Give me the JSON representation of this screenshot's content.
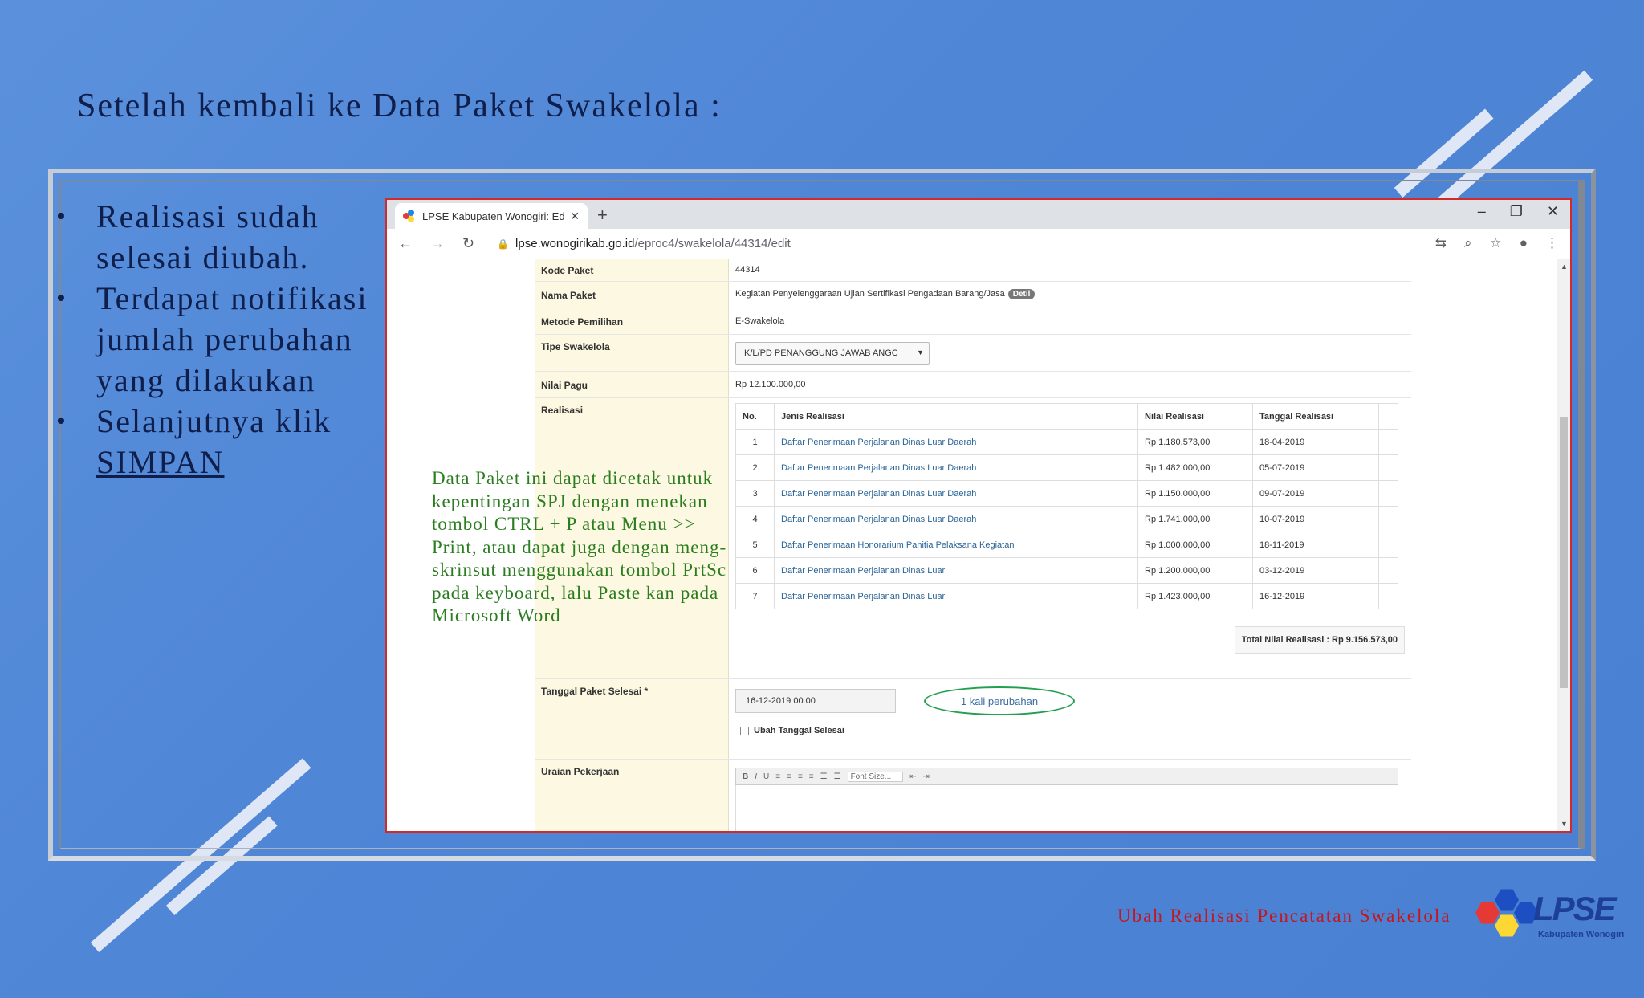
{
  "slide": {
    "title": "Setelah kembali ke Data Paket Swakelola :",
    "bullets": [
      {
        "text": "Realisasi sudah selesai diubah."
      },
      {
        "text": "Terdapat notifikasi jumlah perubahan yang dilakukan"
      },
      {
        "prefix": "Selanjutnya klik ",
        "link": "SIMPAN"
      }
    ],
    "annotation": "Data Paket ini dapat dicetak untuk kepentingan SPJ dengan menekan tombol CTRL + P atau Menu >> Print, atau dapat juga dengan meng-skrinsut menggunakan tombol PrtSc pada keyboard, lalu Paste kan pada Microsoft Word",
    "footer": "Ubah Realisasi Pencatatan Swakelola",
    "logo": {
      "text": "LPSE",
      "subtitle": "Kabupaten Wonogiri"
    }
  },
  "browser": {
    "tab_title": "LPSE Kabupaten Wonogiri: Edit P",
    "url_host": "lpse.wonogirikab.go.id",
    "url_path": "/eproc4/swakelola/44314/edit",
    "icons": [
      "back-arrow-icon",
      "forward-arrow-icon",
      "reload-icon",
      "lock-icon",
      "translate-icon",
      "zoom-icon",
      "star-icon",
      "account-icon",
      "menu-dots-icon"
    ]
  },
  "form": {
    "kode_paket": {
      "label": "Kode Paket",
      "value": "44314"
    },
    "nama_paket": {
      "label": "Nama Paket",
      "value": "Kegiatan Penyelenggaraan Ujian Sertifikasi Pengadaan Barang/Jasa",
      "badge": "Detil"
    },
    "metode": {
      "label": "Metode Pemilihan",
      "value": "E-Swakelola"
    },
    "tipe": {
      "label": "Tipe Swakelola",
      "value": "K/L/PD PENANGGUNG JAWAB ANGC"
    },
    "pagu": {
      "label": "Nilai Pagu",
      "value": "Rp 12.100.000,00"
    },
    "realisasi": {
      "label": "Realisasi",
      "columns": [
        "No.",
        "Jenis Realisasi",
        "Nilai Realisasi",
        "Tanggal Realisasi"
      ],
      "rows": [
        [
          "1",
          "Daftar Penerimaan Perjalanan Dinas Luar Daerah",
          "Rp 1.180.573,00",
          "18-04-2019"
        ],
        [
          "2",
          "Daftar Penerimaan Perjalanan Dinas Luar Daerah",
          "Rp 1.482.000,00",
          "05-07-2019"
        ],
        [
          "3",
          "Daftar Penerimaan Perjalanan Dinas Luar Daerah",
          "Rp 1.150.000,00",
          "09-07-2019"
        ],
        [
          "4",
          "Daftar Penerimaan Perjalanan Dinas Luar Daerah",
          "Rp 1.741.000,00",
          "10-07-2019"
        ],
        [
          "5",
          "Daftar Penerimaan Honorarium Panitia Pelaksana Kegiatan",
          "Rp 1.000.000,00",
          "18-11-2019"
        ],
        [
          "6",
          "Daftar Penerimaan Perjalanan Dinas Luar",
          "Rp 1.200.000,00",
          "03-12-2019"
        ],
        [
          "7",
          "Daftar Penerimaan Perjalanan Dinas Luar",
          "Rp 1.423.000,00",
          "16-12-2019"
        ]
      ],
      "total": "Total Nilai Realisasi : Rp 9.156.573,00"
    },
    "tanggal_selesai": {
      "label": "Tanggal Paket Selesai *",
      "value": "16-12-2019 00:00",
      "note": "1 kali perubahan",
      "checkbox": "Ubah Tanggal Selesai"
    },
    "uraian": {
      "label": "Uraian Pekerjaan",
      "font_size_placeholder": "Font Size..."
    }
  },
  "colors": {
    "slide_bg": "#4f86d6",
    "title": "#0f1e4a",
    "annotation": "#2a7d1e",
    "footer": "#c4161c",
    "highlight_ellipse": "#22a050",
    "browser_border": "#d22a2a"
  }
}
